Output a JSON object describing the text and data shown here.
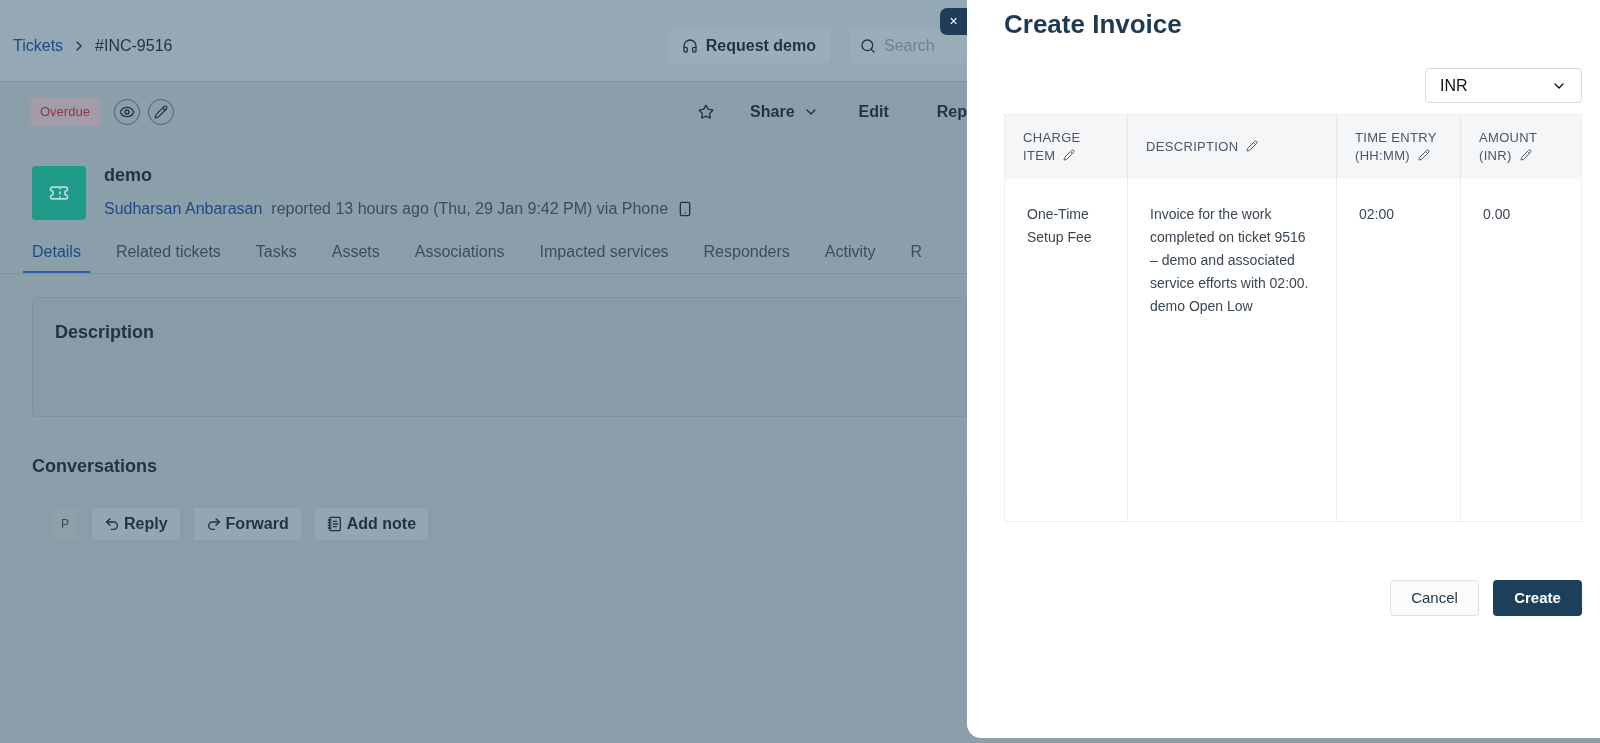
{
  "breadcrumb": {
    "root": "Tickets",
    "current": "#INC-9516"
  },
  "header": {
    "request_demo": "Request demo",
    "search": {
      "placeholder": "Search"
    }
  },
  "ticket": {
    "status_badge": "Overdue",
    "actions": [
      "Share",
      "Edit",
      "Rep"
    ],
    "title": "demo",
    "reporter": "Sudharsan Anbarasan",
    "reported_text": "reported 13 hours ago (Thu, 29 Jan 9:42 PM) via Phone"
  },
  "tabs": [
    {
      "label": "Details",
      "selected": true
    },
    {
      "label": "Related tickets",
      "selected": false
    },
    {
      "label": "Tasks",
      "selected": false
    },
    {
      "label": "Assets",
      "selected": false
    },
    {
      "label": "Associations",
      "selected": false
    },
    {
      "label": "Impacted services",
      "selected": false
    },
    {
      "label": "Responders",
      "selected": false
    },
    {
      "label": "Activity",
      "selected": false
    },
    {
      "label": "R",
      "selected": false
    }
  ],
  "description": {
    "title": "Description"
  },
  "conversations": {
    "title": "Conversations",
    "avatar": "P",
    "actions": [
      {
        "kind": "reply",
        "label": "Reply"
      },
      {
        "kind": "forward",
        "label": "Forward"
      },
      {
        "kind": "note",
        "label": "Add note"
      }
    ]
  },
  "dialog": {
    "close": "×",
    "title": "Create Invoice",
    "currency": "INR",
    "table": {
      "columns": [
        "CHARGE ITEM",
        "DESCRIPTION",
        "TIME ENTRY (HH:MM)",
        "AMOUNT (INR)"
      ],
      "rows": [
        [
          "One-Time Setup Fee",
          "Invoice for the work completed on ticket 9516 – demo and associated service efforts with 02:00. demo Open Low",
          "02:00",
          "0.00"
        ]
      ]
    },
    "buttons": [
      {
        "kind": "secondary",
        "label": "Cancel"
      },
      {
        "kind": "primary",
        "label": "Create"
      }
    ]
  }
}
